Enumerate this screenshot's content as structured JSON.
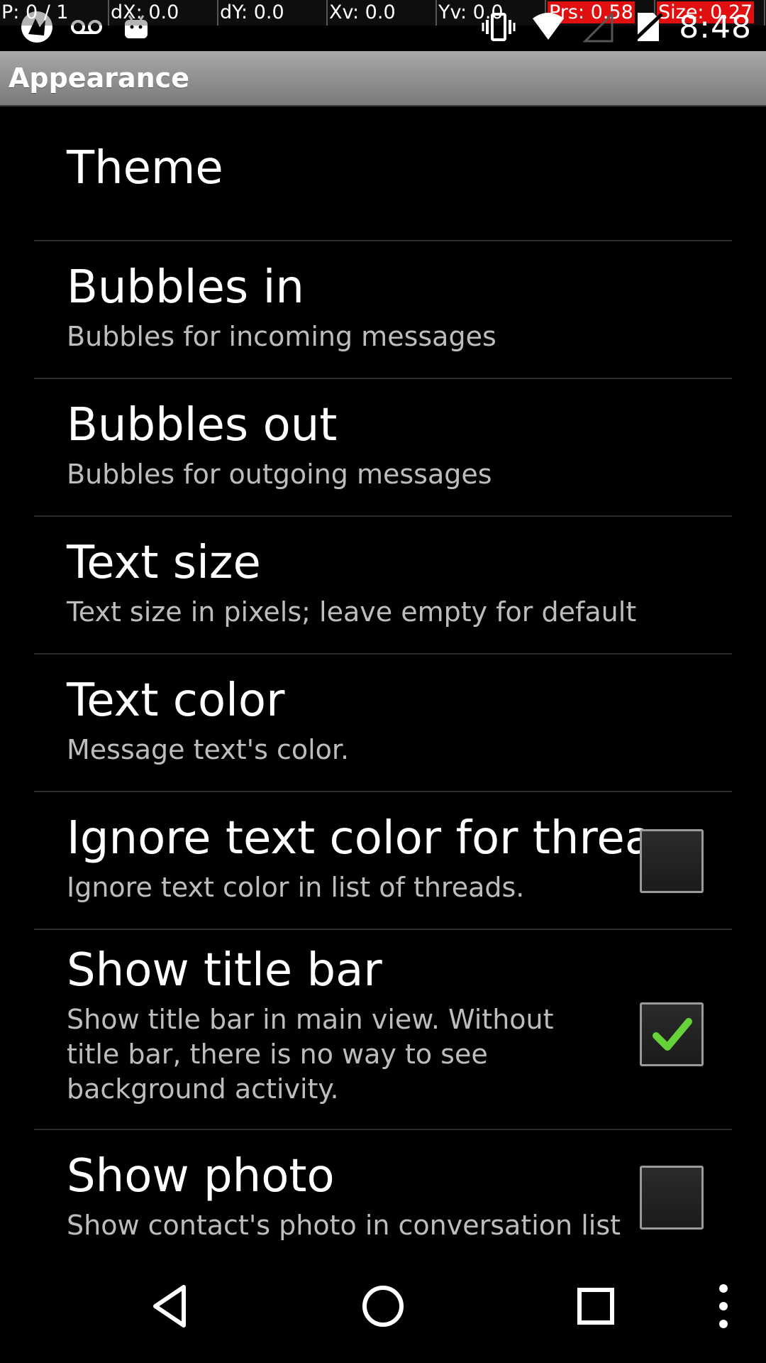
{
  "debug": {
    "p": "P: 0 / 1",
    "dx": "dX: 0.0",
    "dy": "dY: 0.0",
    "xv": "Xv: 0.0",
    "yv": "Yv: 0.0",
    "prs": "Prs: 0.58",
    "size": "Size: 0.27"
  },
  "status": {
    "clock": "8:48",
    "icons": [
      "app-notification-icon",
      "voicemail-icon",
      "android-icon",
      "vibrate-icon",
      "wifi-icon",
      "no-signal-icon",
      "no-sim-icon"
    ]
  },
  "titlebar": {
    "title": "Appearance"
  },
  "settings": {
    "theme": {
      "title": "Theme"
    },
    "bubbles_in": {
      "title": "Bubbles in",
      "summary": "Bubbles for incoming messages"
    },
    "bubbles_out": {
      "title": "Bubbles out",
      "summary": "Bubbles for outgoing messages"
    },
    "text_size": {
      "title": "Text size",
      "summary": "Text size in pixels; leave empty for default"
    },
    "text_color": {
      "title": "Text color",
      "summary": "Message text's color."
    },
    "ignore_color": {
      "title": "Ignore text color for threa..",
      "summary": "Ignore text color in list of threads.",
      "checked": false
    },
    "show_title_bar": {
      "title": "Show title bar",
      "summary": "Show title bar in main view. Without title bar, there is no way to see background activity.",
      "checked": true
    },
    "show_photo": {
      "title": "Show photo",
      "summary": "Show contact's photo in conversation list",
      "checked": false
    }
  },
  "navbar": {
    "icons": [
      "back-icon",
      "home-icon",
      "recents-icon",
      "overflow-menu-icon"
    ]
  },
  "colors": {
    "background": "#000000",
    "titlebar": "#8f8f8f",
    "summary_text": "#bdbdbd",
    "check_green": "#66d23a",
    "divider": "#2a2a2a",
    "debug_highlight": "#e01010"
  }
}
